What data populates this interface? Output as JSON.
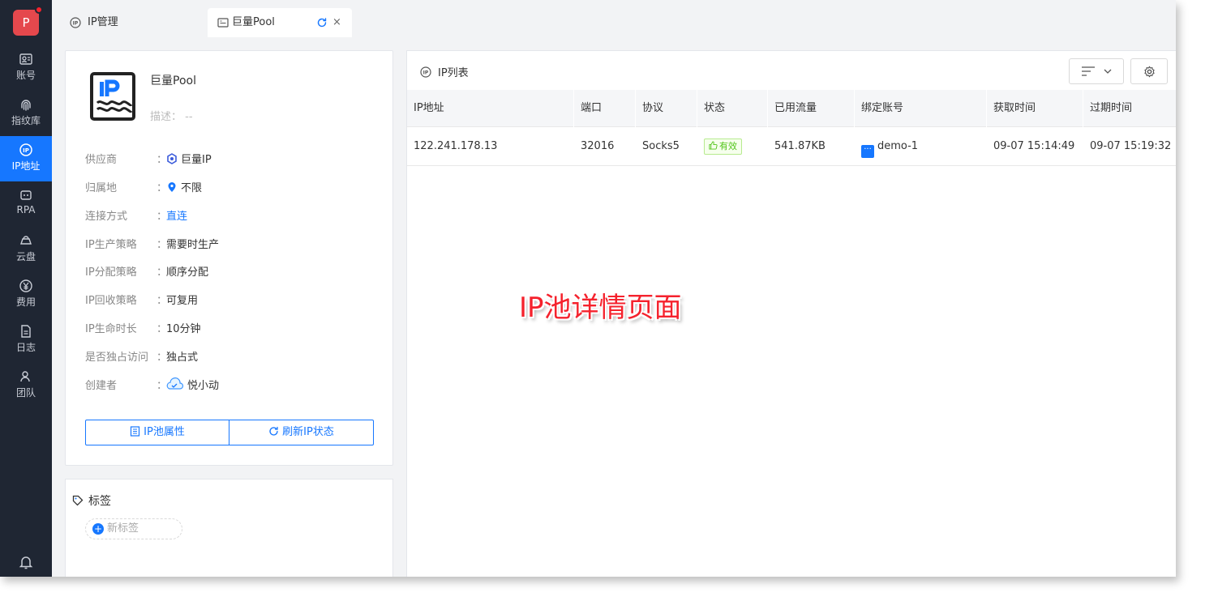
{
  "nav": {
    "logo": "P",
    "items": [
      {
        "label": "账号",
        "icon": "id-card-icon"
      },
      {
        "label": "指纹库",
        "icon": "fingerprint-icon"
      },
      {
        "label": "IP地址",
        "icon": "ip-icon"
      },
      {
        "label": "RPA",
        "icon": "robot-icon"
      },
      {
        "label": "云盘",
        "icon": "cloud-drive-icon"
      },
      {
        "label": "费用",
        "icon": "yen-icon"
      },
      {
        "label": "日志",
        "icon": "document-icon"
      },
      {
        "label": "团队",
        "icon": "team-icon"
      }
    ],
    "active_index": 2
  },
  "tabs": [
    {
      "label": "IP管理"
    },
    {
      "label": "巨量Pool",
      "close": "×"
    }
  ],
  "pool": {
    "name": "巨量Pool",
    "description": "描述： --",
    "separator": "：",
    "props": [
      {
        "key": "供应商",
        "value": "巨量IP",
        "icon": "provider-icon"
      },
      {
        "key": "归属地",
        "value": "不限",
        "icon": "location-pin-icon"
      },
      {
        "key": "连接方式",
        "value": "直连",
        "link": true
      },
      {
        "key": "IP生产策略",
        "value": "需要时生产"
      },
      {
        "key": "IP分配策略",
        "value": "顺序分配"
      },
      {
        "key": "IP回收策略",
        "value": "可复用"
      },
      {
        "key": "IP生命时长",
        "value": "10分钟"
      },
      {
        "key": "是否独占访问",
        "value": "独占式"
      },
      {
        "key": "创建者",
        "value": "悦小动",
        "icon": "user-avatar-icon"
      }
    ],
    "buttons": {
      "properties": "IP池属性",
      "refresh": "刷新IP状态"
    }
  },
  "tags": {
    "title": "标签",
    "new_tag": "新标签"
  },
  "ip_list": {
    "title": "IP列表",
    "columns": [
      "IP地址",
      "端口",
      "协议",
      "状态",
      "已用流量",
      "绑定账号",
      "获取时间",
      "过期时间"
    ],
    "rows": [
      {
        "ip": "122.241.178.13",
        "port": "32016",
        "protocol": "Socks5",
        "status": "有效",
        "traffic": "541.87KB",
        "account": "demo-1",
        "acquired": "09-07 15:14:49",
        "expires": "09-07 15:19:32"
      }
    ]
  },
  "annotation": "IP池详情页面",
  "colors": {
    "accent": "#1677ff",
    "nav_bg": "#1f2633",
    "logo": "#e5484d",
    "status_ok": "#52c41a",
    "annotation": "#f5222d"
  }
}
